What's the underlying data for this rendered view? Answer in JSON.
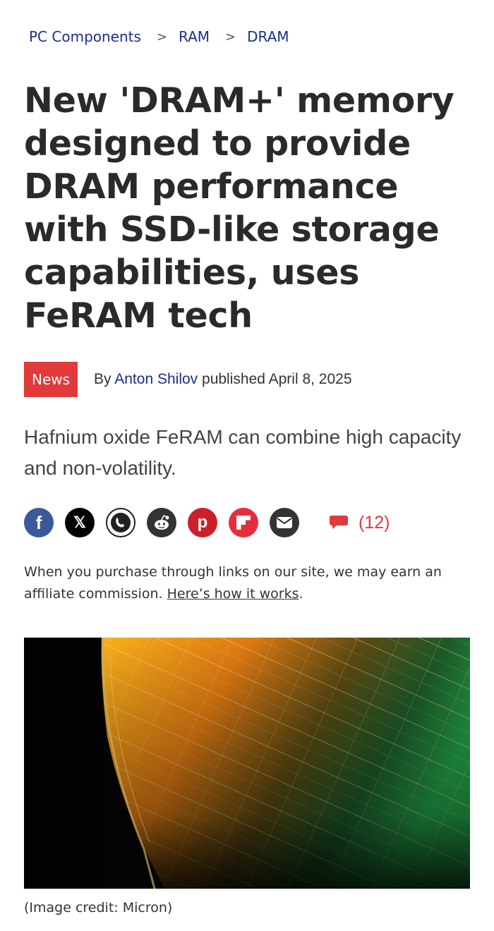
{
  "breadcrumb": {
    "items": [
      "PC Components",
      "RAM",
      "DRAM"
    ],
    "separator": ">"
  },
  "article": {
    "title": "New 'DRAM+' memory designed to provide DRAM performance with SSD-like storage capabilities, uses FeRAM tech",
    "category": "News",
    "by_prefix": "By",
    "author": "Anton Shilov",
    "published_prefix": "published",
    "date": "April 8, 2025",
    "standfirst": "Hafnium oxide FeRAM can combine high capacity and non-volatility."
  },
  "share": {
    "icons": [
      "facebook-icon",
      "x-icon",
      "whatsapp-icon",
      "reddit-icon",
      "pinterest-icon",
      "flipboard-icon",
      "email-icon"
    ],
    "comment_count": "(12)"
  },
  "disclosure": {
    "text": "When you purchase through links on our site, we may earn an affiliate commission. ",
    "link": "Here’s how it works",
    "suffix": "."
  },
  "image": {
    "credit": "(Image credit: Micron)"
  },
  "colors": {
    "accent": "#e03a3a",
    "link": "#1a2f8c",
    "title": "#2a2a2a"
  }
}
